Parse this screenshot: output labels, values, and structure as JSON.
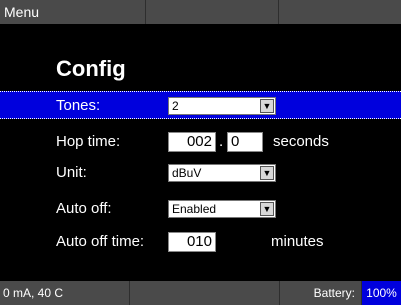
{
  "menu": {
    "label": "Menu"
  },
  "page": {
    "title": "Config"
  },
  "fields": {
    "tones": {
      "label": "Tones:",
      "value": "2"
    },
    "hop_time": {
      "label": "Hop time:",
      "whole": "002",
      "separator": ".",
      "fraction": "0",
      "unit": "seconds"
    },
    "unit": {
      "label": "Unit:",
      "value": "dBuV"
    },
    "auto_off": {
      "label": "Auto off:",
      "value": "Enabled"
    },
    "auto_off_time": {
      "label": "Auto off time:",
      "value": "010",
      "unit": "minutes"
    }
  },
  "status": {
    "readings": "0 mA, 40 C",
    "battery_label": "Battery:",
    "battery_value": "100%"
  },
  "icons": {
    "dropdown": "dropdown-arrow-icon"
  },
  "colors": {
    "bar": "#4a4a4a",
    "highlight": "#0000dd",
    "background": "#000000"
  }
}
